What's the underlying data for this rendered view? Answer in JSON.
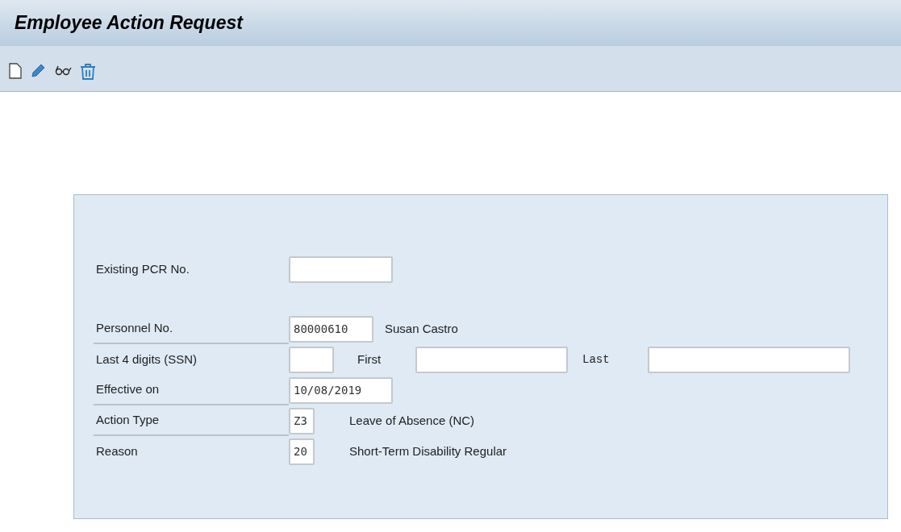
{
  "window": {
    "title": "Employee Action Request"
  },
  "toolbar": [
    {
      "kind": "new"
    },
    {
      "kind": "edit"
    },
    {
      "kind": "display"
    },
    {
      "kind": "delete"
    }
  ],
  "form": {
    "existing_pcr": {
      "label": "Existing PCR No."
    },
    "personnel": {
      "label": "Personnel No.",
      "underlined": true,
      "value": "80000610",
      "name": "Susan Castro"
    },
    "ssn": {
      "label": "Last 4 digits (SSN)",
      "underlined": false,
      "first_label": "First",
      "last_label": "Last"
    },
    "effective": {
      "label": "Effective on",
      "underlined": true,
      "value": "10/08/2019"
    },
    "action_type": {
      "label": "Action Type",
      "underlined": true,
      "value": "Z3",
      "description": "Leave of Absence (NC)"
    },
    "reason": {
      "label": "Reason",
      "underlined": false,
      "value": "20",
      "description": "Short-Term Disability Regular"
    }
  }
}
